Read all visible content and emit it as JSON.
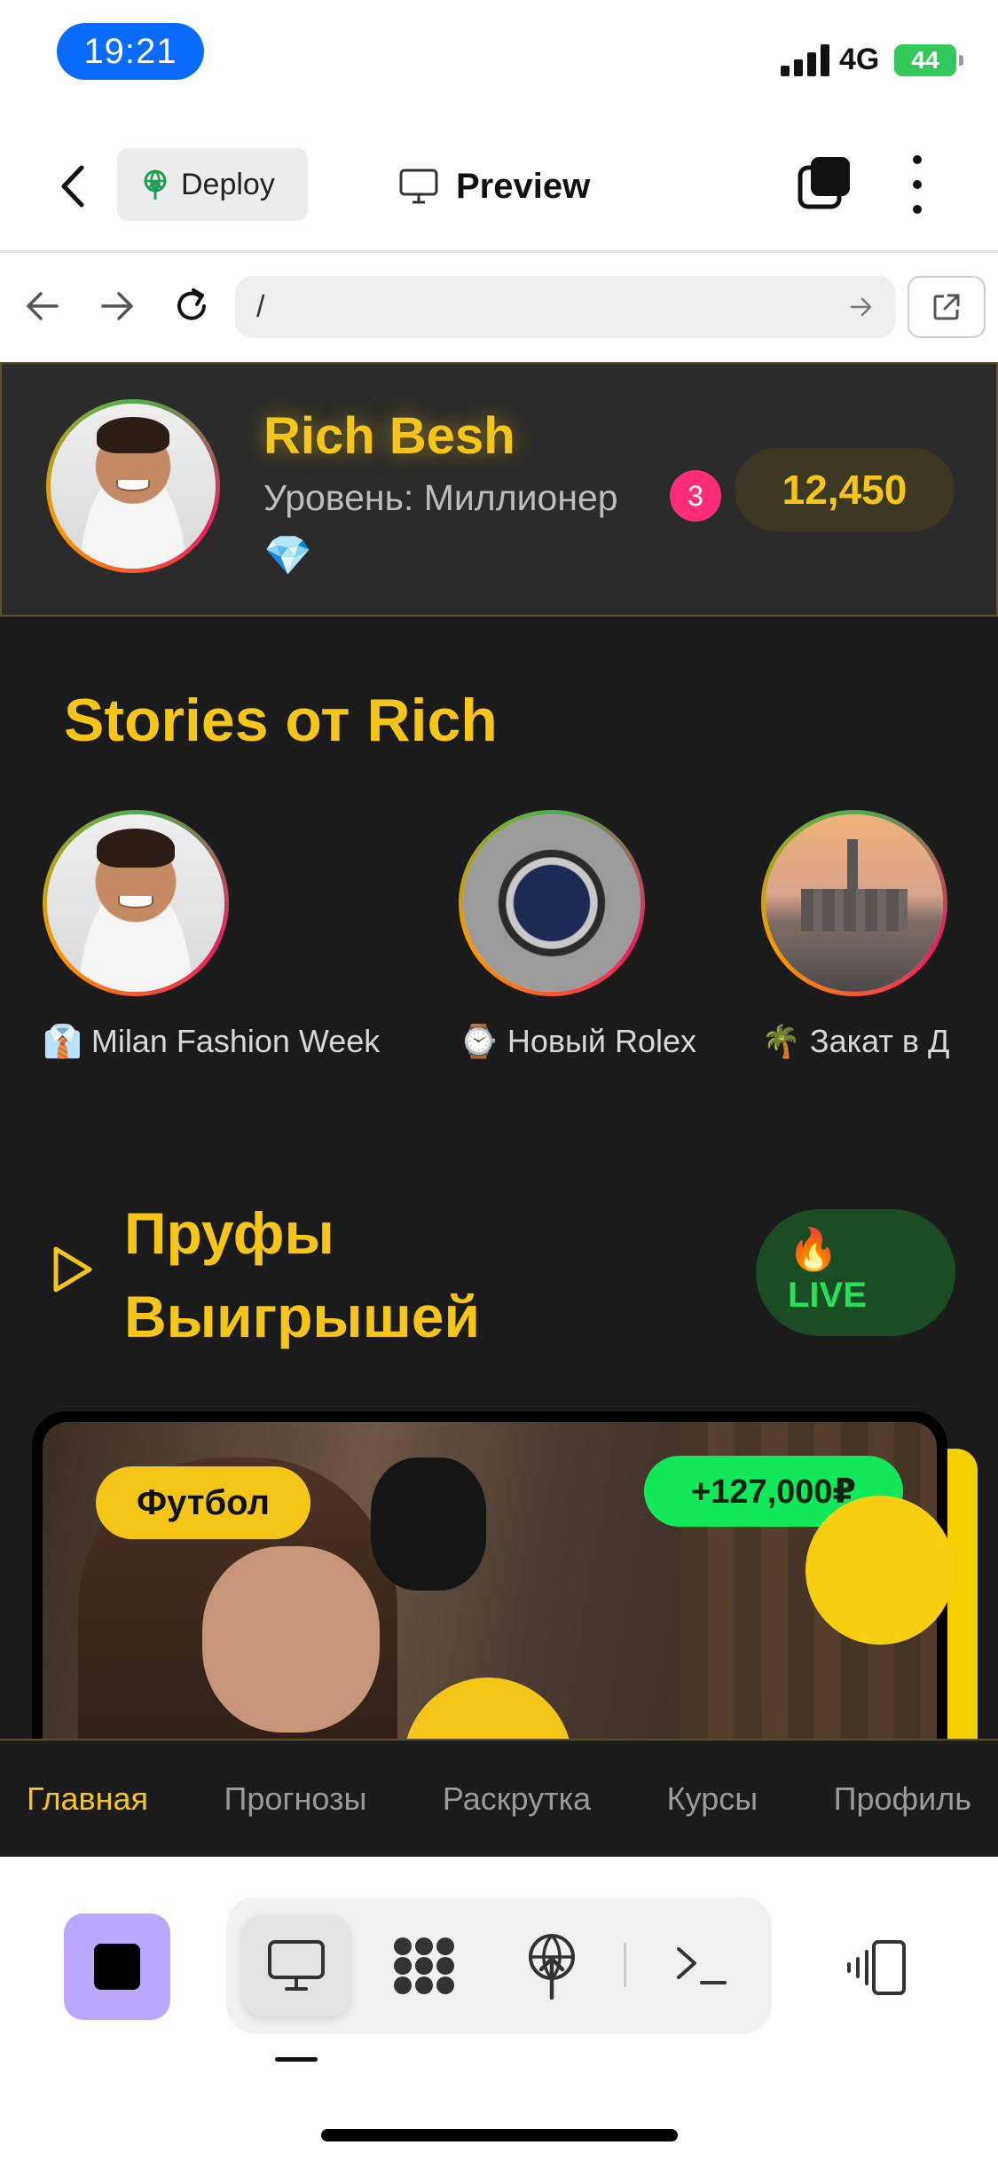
{
  "status_bar": {
    "time": "19:21",
    "network": "4G",
    "battery": "44"
  },
  "header": {
    "deploy_label": "Deploy",
    "preview_label": "Preview"
  },
  "browser": {
    "url": "/"
  },
  "profile": {
    "name": "Rich Besh",
    "level": "Уровень: Миллионер",
    "badge_count": "3",
    "gem": "💎",
    "coins": "12,450"
  },
  "stories": {
    "title": "Stories от Rich",
    "items": [
      {
        "label": "👔 Milan Fashion Week"
      },
      {
        "label": "⌚ Новый Rolex"
      },
      {
        "label": "🌴 Закат в Д"
      }
    ]
  },
  "proofs": {
    "title_line1": "Пруфы",
    "title_line2": "Выигрышей",
    "live_emoji": "🔥",
    "live_label": "LIVE",
    "card": {
      "sport": "Футбол",
      "win": "+127,000₽"
    }
  },
  "web_nav": {
    "items": [
      {
        "label": "Главная"
      },
      {
        "label": "Прогнозы"
      },
      {
        "label": "Раскрутка"
      },
      {
        "label": "Курсы"
      },
      {
        "label": "Профиль"
      }
    ]
  },
  "colors": {
    "accent": "#f5c518",
    "live_green": "#27e05a",
    "win_green": "#12e85a",
    "badge_pink": "#ff2d78",
    "stop_purple": "#bca7ff",
    "time_blue": "#0a6cff"
  },
  "icons": [
    "back-icon",
    "deploy-icon",
    "monitor-icon",
    "layers-icon",
    "more-icon",
    "arrow-left-icon",
    "arrow-right-icon",
    "reload-icon",
    "go-icon",
    "external-link-icon",
    "play-icon",
    "stop-icon",
    "apps-icon",
    "deploy-tool-icon",
    "terminal-icon",
    "devices-icon"
  ]
}
